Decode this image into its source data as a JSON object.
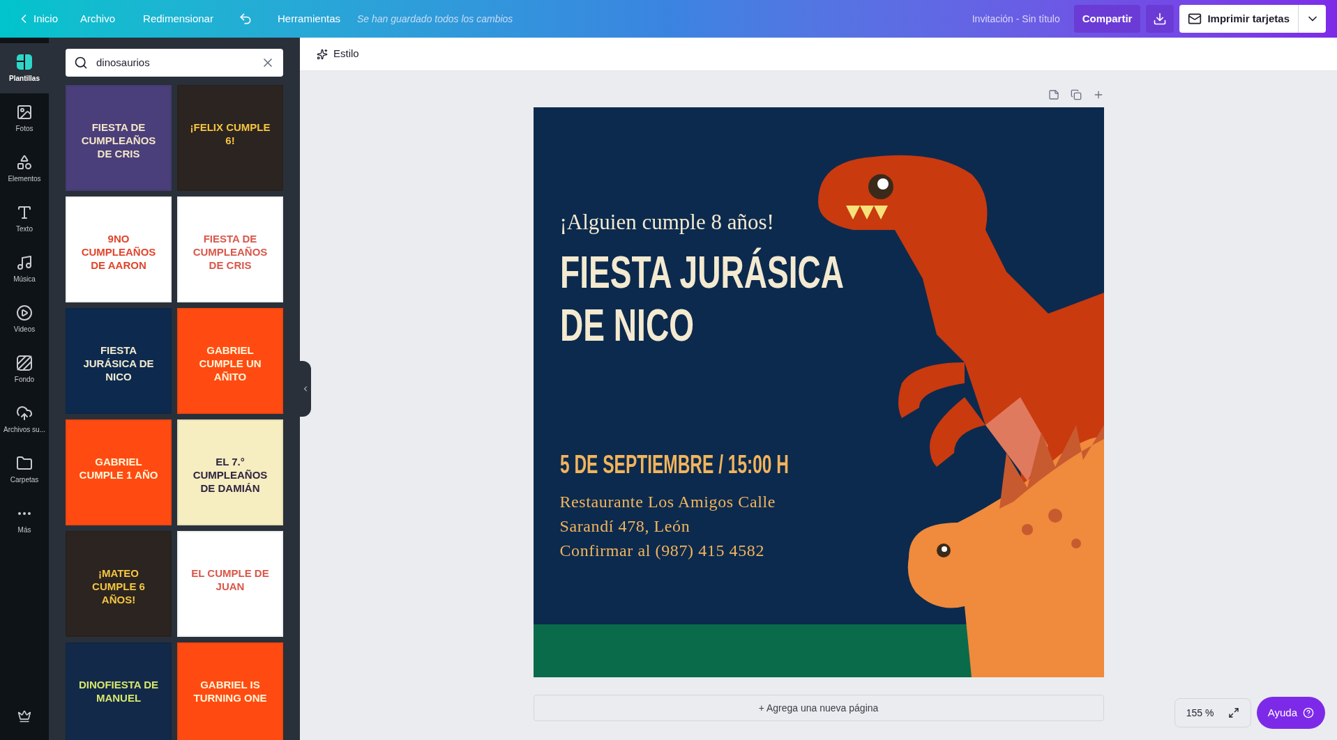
{
  "top_bar": {
    "back": "Inicio",
    "menu": [
      "Archivo",
      "Redimensionar"
    ],
    "tools": "Herramientas",
    "save_status": "Se han guardado todos los cambios",
    "doc_title": "Invitación - Sin título",
    "share": "Compartir",
    "print": "Imprimir tarjetas"
  },
  "rail": [
    {
      "kind": "templates",
      "label": "Plantillas",
      "selected": true
    },
    {
      "kind": "photos",
      "label": "Fotos",
      "selected": false
    },
    {
      "kind": "elements",
      "label": "Elementos",
      "selected": false
    },
    {
      "kind": "text",
      "label": "Texto",
      "selected": false
    },
    {
      "kind": "music",
      "label": "Música",
      "selected": false
    },
    {
      "kind": "videos",
      "label": "Videos",
      "selected": false
    },
    {
      "kind": "background",
      "label": "Fondo",
      "selected": false
    },
    {
      "kind": "uploads",
      "label": "Archivos su...",
      "selected": false
    },
    {
      "kind": "folders",
      "label": "Carpetas",
      "selected": false
    },
    {
      "kind": "more",
      "label": "Más",
      "selected": false
    }
  ],
  "search": {
    "value": "dinosaurios"
  },
  "templates": [
    {
      "title": {
        "text": "FIESTA DE CUMPLEAÑOS DE CRIS",
        "color": "#f3e6c8"
      },
      "color": "#4a3f7a"
    },
    {
      "title": {
        "text": "¡FELIX CUMPLE 6!",
        "color": "#f5c542"
      },
      "color": "#2b2420"
    },
    {
      "title": {
        "text": "9NO CUMPLEAÑOS DE AARON",
        "color": "#e0452b"
      },
      "color": "#ffffff"
    },
    {
      "title": {
        "text": "FIESTA DE CUMPLEAÑOS DE CRIS",
        "color": "#d9574a"
      },
      "color": "#ffffff"
    },
    {
      "title": {
        "text": "FIESTA JURÁSICA DE NICO",
        "color": "#f3ead0"
      },
      "color": "#0d2a4e"
    },
    {
      "title": {
        "text": "GABRIEL CUMPLE UN AÑITO",
        "color": "#fff6d8"
      },
      "color": "#ff4b12"
    },
    {
      "title": {
        "text": "GABRIEL CUMPLE 1 AÑO",
        "color": "#fff6d8"
      },
      "color": "#ff4b12"
    },
    {
      "title": {
        "text": "EL 7.° CUMPLEAÑOS DE DAMIÁN",
        "color": "#2e2440"
      },
      "color": "#f6edc0"
    },
    {
      "title": {
        "text": "¡MATEO CUMPLE 6 AÑOS!",
        "color": "#f5c542"
      },
      "color": "#2b2420"
    },
    {
      "title": {
        "text": "EL CUMPLE DE JUAN",
        "color": "#d9574a"
      },
      "color": "#ffffff"
    },
    {
      "title": {
        "text": "DINOFIESTA DE MANUEL",
        "color": "#d8e86a"
      },
      "color": "#13294a"
    },
    {
      "title": {
        "text": "GABRIEL IS TURNING ONE",
        "color": "#fff6d8"
      },
      "color": "#ff4b12"
    }
  ],
  "toolbar": {
    "style": "Estilo"
  },
  "page": {
    "kicker": "¡Alguien cumple 8 años!",
    "title": [
      "FIESTA JURÁSICA",
      "DE NICO"
    ],
    "date": "5 DE SEPTIEMBRE / 15:00 H",
    "details": [
      "Restaurante Los Amigos Calle",
      "Sarandí 478, León",
      "Confirmar al (987) 415 4582"
    ]
  },
  "add_page": "+ Agrega una nueva página",
  "zoom": "155 %",
  "help": "Ayuda"
}
